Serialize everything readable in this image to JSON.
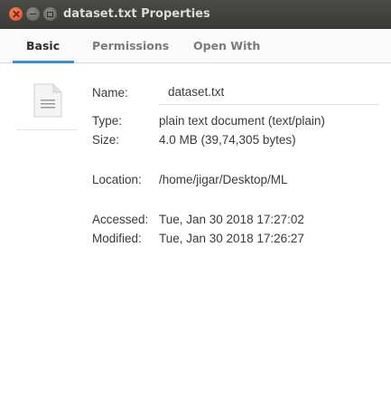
{
  "window": {
    "title": "dataset.txt Properties"
  },
  "tabs": [
    {
      "label": "Basic",
      "active": true
    },
    {
      "label": "Permissions",
      "active": false
    },
    {
      "label": "Open With",
      "active": false
    }
  ],
  "properties": {
    "name_label": "Name:",
    "name_value": "dataset.txt",
    "type_label": "Type:",
    "type_value": "plain text document (text/plain)",
    "size_label": "Size:",
    "size_value": "4.0 MB (39,74,305 bytes)",
    "location_label": "Location:",
    "location_value": "/home/jigar/Desktop/ML",
    "accessed_label": "Accessed:",
    "accessed_value": "Tue, Jan 30 2018 17:27:02",
    "modified_label": "Modified:",
    "modified_value": "Tue, Jan 30 2018 17:26:27"
  },
  "icons": {
    "file": "text-file-icon",
    "close": "close-icon",
    "minimize": "minimize-icon",
    "maximize": "maximize-icon"
  },
  "colors": {
    "titlebar": "#3c3c39",
    "close_button": "#df4b16",
    "tab_accent": "#3d8fd6"
  }
}
